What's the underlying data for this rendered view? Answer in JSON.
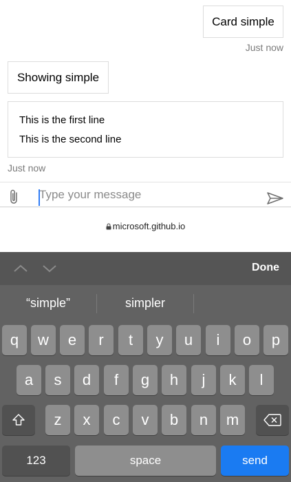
{
  "chat": {
    "user_message": "Card simple",
    "user_timestamp": "Just now",
    "bot_message": "Showing simple",
    "card_lines": [
      "This is the first line",
      "This is the second line"
    ],
    "bot_timestamp": "Just now"
  },
  "composer": {
    "placeholder": "Type your message",
    "value": ""
  },
  "browser": {
    "url": "microsoft.github.io"
  },
  "accessory_bar": {
    "done_label": "Done"
  },
  "keyboard": {
    "suggestions": [
      "“simple”",
      "simpler",
      ""
    ],
    "row1": [
      "q",
      "w",
      "e",
      "r",
      "t",
      "y",
      "u",
      "i",
      "o",
      "p"
    ],
    "row2": [
      "a",
      "s",
      "d",
      "f",
      "g",
      "h",
      "j",
      "k",
      "l"
    ],
    "row3": [
      "z",
      "x",
      "c",
      "v",
      "b",
      "n",
      "m"
    ],
    "numbers_label": "123",
    "space_label": "space",
    "send_label": "send",
    "send_color": "#1a7bf2"
  }
}
